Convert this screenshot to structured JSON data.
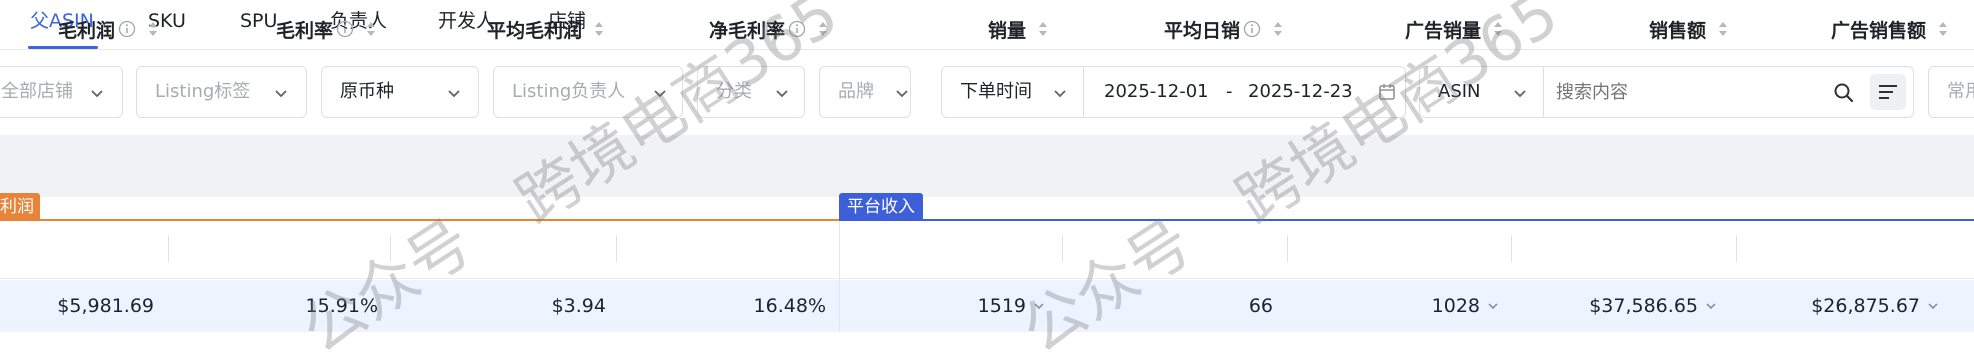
{
  "tabs": [
    {
      "label": "父ASIN",
      "active": true
    },
    {
      "label": "SKU"
    },
    {
      "label": "SPU"
    },
    {
      "label": "负责人"
    },
    {
      "label": "开发人"
    },
    {
      "label": "店铺"
    }
  ],
  "filters": {
    "store": "全部店铺",
    "listing_tag": "Listing标签",
    "currency": "原币种",
    "listing_owner": "Listing负责人",
    "category": "分类",
    "brand": "品牌",
    "time_type": "下单时间",
    "date_start": "2025-12-01",
    "date_sep": "-",
    "date_end": "2025-12-23",
    "search_type": "ASIN",
    "search_placeholder": "搜索内容",
    "common": "常用"
  },
  "groups": {
    "profit_partial": "利润",
    "platform_income": "平台收入"
  },
  "columns": [
    {
      "key": "gross_profit",
      "label": "毛利润",
      "info": true
    },
    {
      "key": "gross_margin",
      "label": "毛利率",
      "info": true
    },
    {
      "key": "avg_gross_profit",
      "label": "平均毛利润",
      "info": false
    },
    {
      "key": "net_margin",
      "label": "净毛利率",
      "info": true
    },
    {
      "key": "sales_qty",
      "label": "销量",
      "info": false
    },
    {
      "key": "avg_daily_sales",
      "label": "平均日销",
      "info": true
    },
    {
      "key": "ad_sales_qty",
      "label": "广告销量",
      "info": false
    },
    {
      "key": "sales_amount",
      "label": "销售额",
      "info": false
    },
    {
      "key": "ad_sales_amount",
      "label": "广告销售额",
      "info": false
    }
  ],
  "row": {
    "gross_profit": "$5,981.69",
    "gross_margin": "15.91%",
    "avg_gross_profit": "$3.94",
    "net_margin": "16.48%",
    "sales_qty": "1519",
    "avg_daily_sales": "66",
    "ad_sales_qty": "1028",
    "sales_amount": "$37,586.65",
    "ad_sales_amount": "$26,875.67"
  },
  "watermark": {
    "line1": "跨境电商365",
    "line2": "公众号"
  },
  "colors": {
    "accent": "#3d63dd",
    "profit_group": "#e8833a",
    "platform_group": "#3d5fd8",
    "row_highlight": "#edf3ff"
  }
}
